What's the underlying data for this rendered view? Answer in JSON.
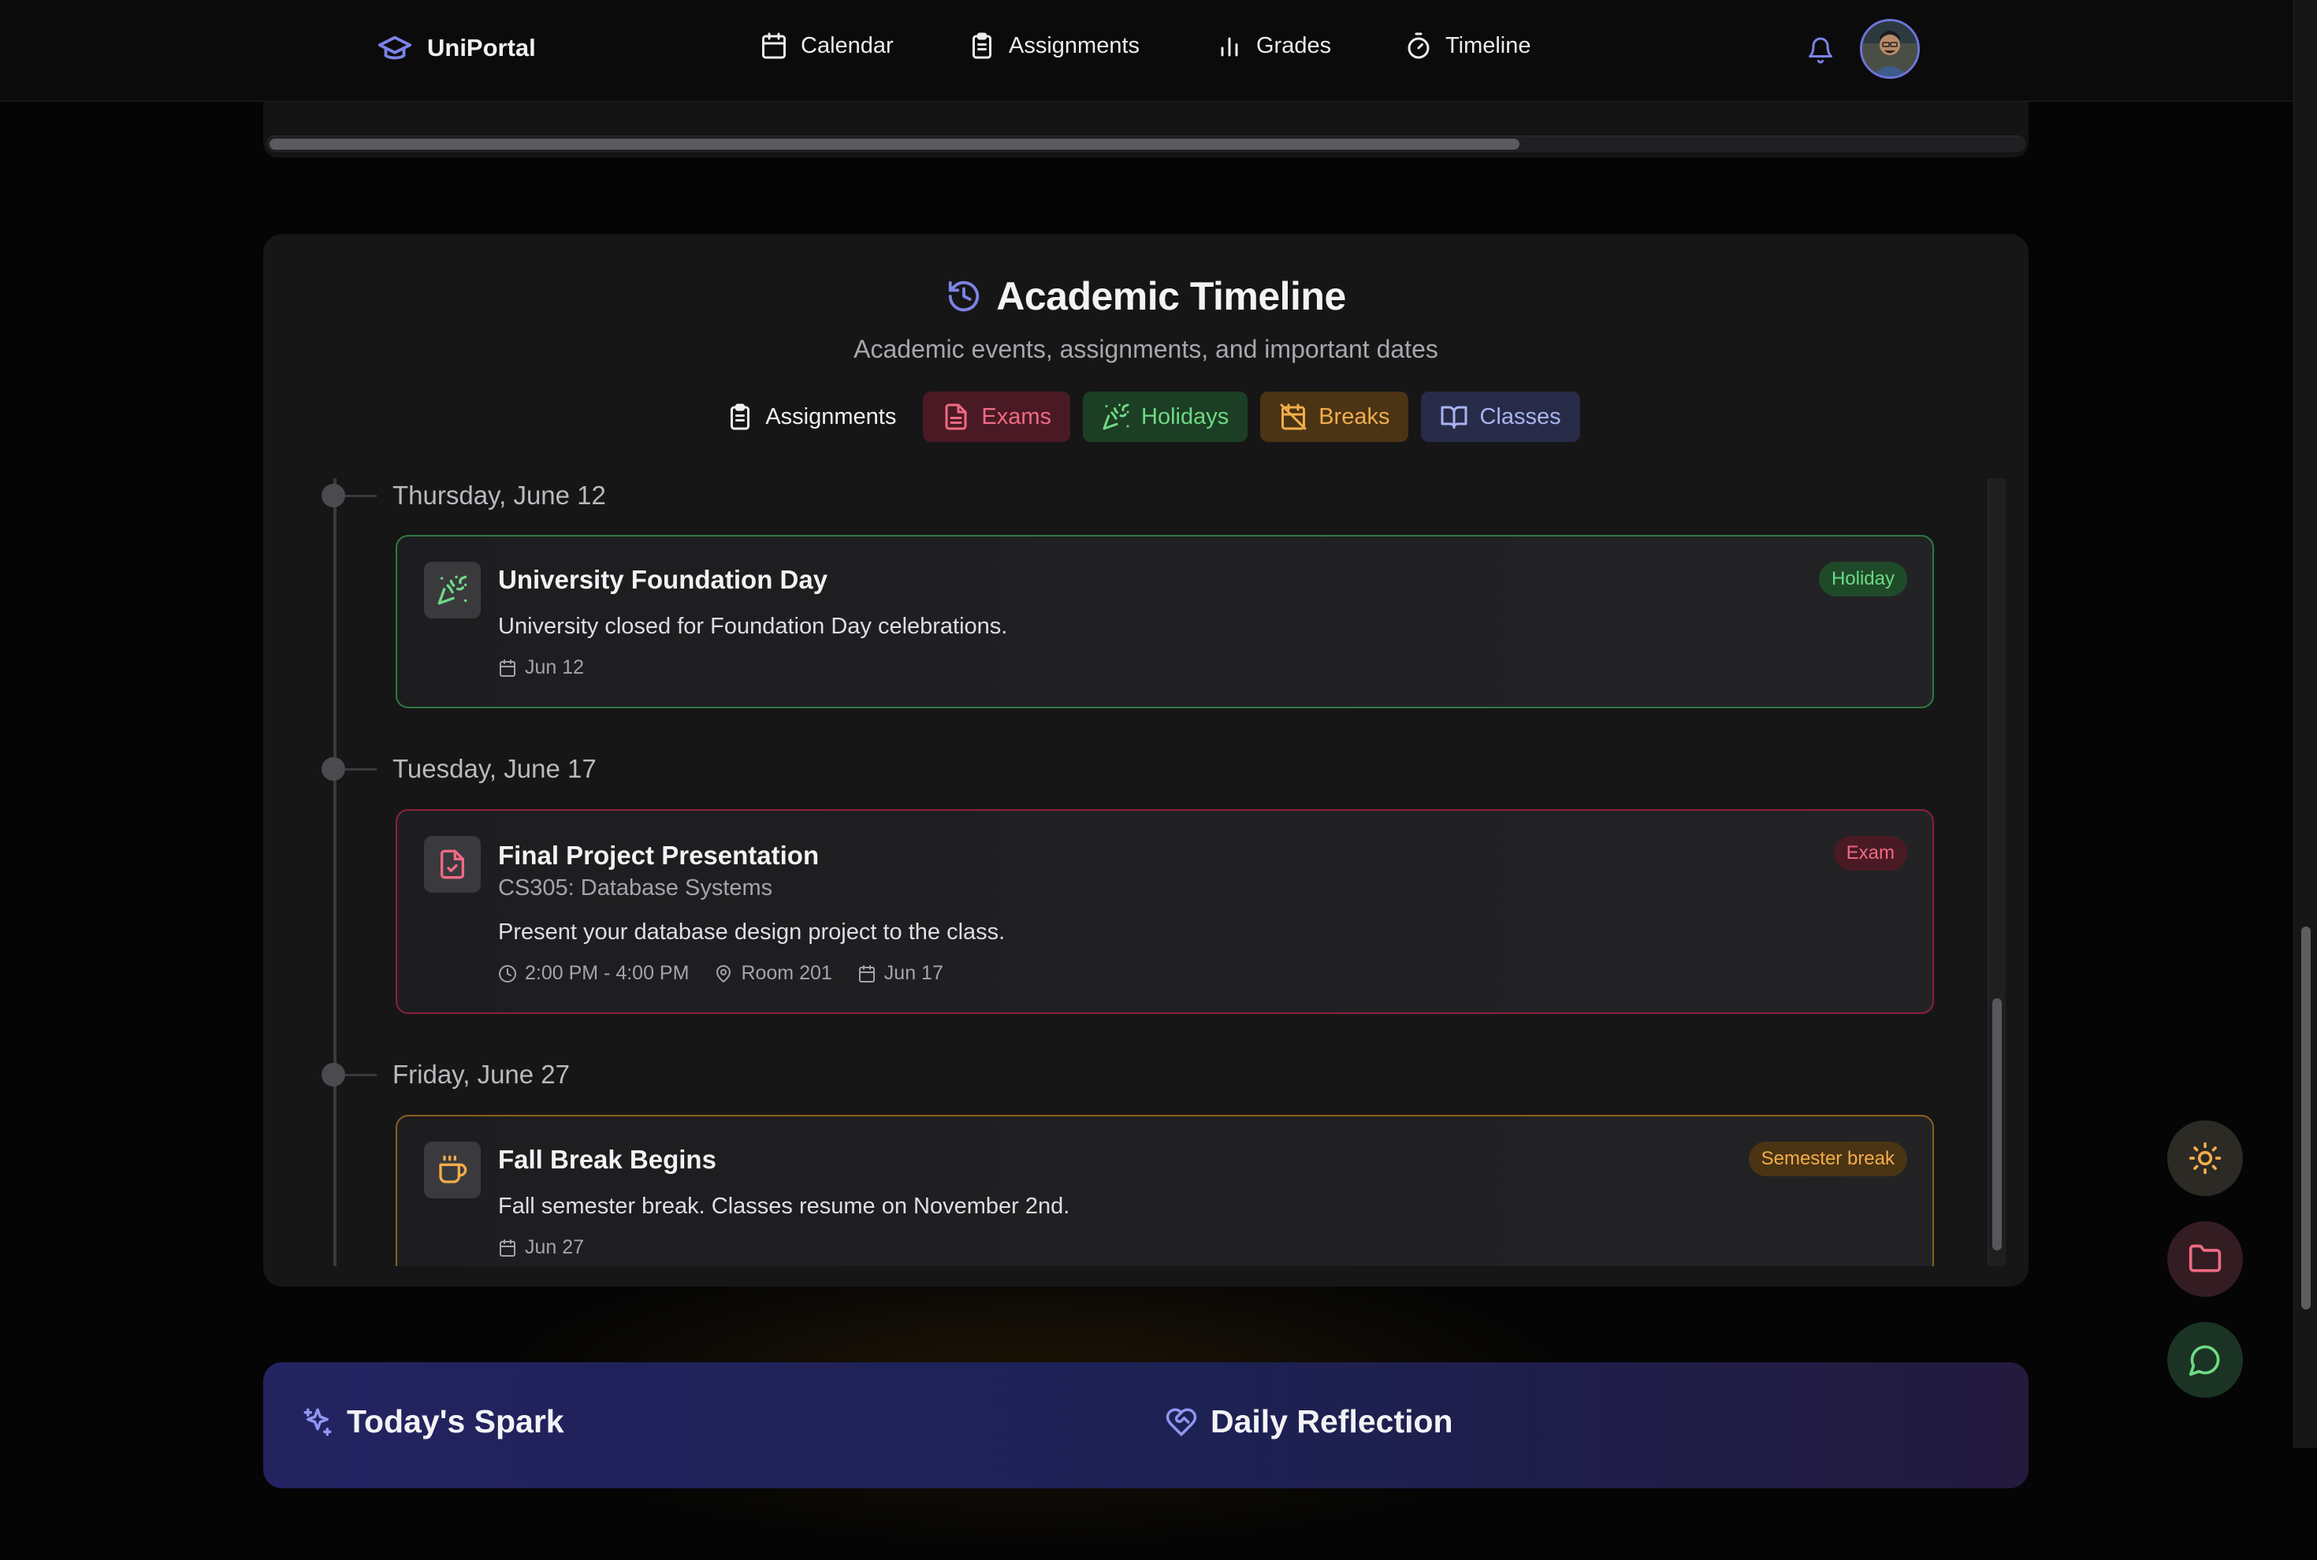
{
  "app": {
    "brand": "UniPortal"
  },
  "nav": {
    "items": [
      {
        "label": "Calendar",
        "icon": "calendar-icon"
      },
      {
        "label": "Assignments",
        "icon": "clipboard-icon"
      },
      {
        "label": "Grades",
        "icon": "bar-chart-icon"
      },
      {
        "label": "Timeline",
        "icon": "timer-icon"
      }
    ]
  },
  "timeline": {
    "title": "Academic Timeline",
    "subtitle": "Academic events, assignments, and important dates",
    "filters": [
      {
        "label": "Assignments",
        "icon": "clipboard-icon"
      },
      {
        "label": "Exams",
        "icon": "file-text-icon",
        "color": "#f06a84"
      },
      {
        "label": "Holidays",
        "icon": "party-popper-icon",
        "color": "#6fd983"
      },
      {
        "label": "Breaks",
        "icon": "calendar-off-icon",
        "color": "#f2ad4b"
      },
      {
        "label": "Classes",
        "icon": "book-open-icon",
        "color": "#a9b4ef"
      }
    ],
    "groups": [
      {
        "date": "Thursday, June 12",
        "event": {
          "title": "University Foundation Day",
          "description": "University closed for Foundation Day celebrations.",
          "date_short": "Jun 12",
          "badge": "Holiday",
          "icon": "party-popper-icon"
        }
      },
      {
        "date": "Tuesday, June 17",
        "event": {
          "title": "Final Project Presentation",
          "course": "CS305: Database Systems",
          "description": "Present your database design project to the class.",
          "time": "2:00 PM - 4:00 PM",
          "location": "Room 201",
          "date_short": "Jun 17",
          "badge": "Exam",
          "icon": "file-check-icon"
        }
      },
      {
        "date": "Friday, June 27",
        "event": {
          "title": "Fall Break Begins",
          "description": "Fall semester break. Classes resume on November 2nd.",
          "date_short": "Jun 27",
          "badge": "Semester break",
          "icon": "coffee-icon"
        }
      }
    ]
  },
  "bottom": {
    "spark_title": "Today's Spark",
    "reflection_title": "Daily Reflection"
  },
  "colors": {
    "accent": "#6d74d9",
    "holiday": "#6fd983",
    "exam": "#f06a84",
    "break": "#f2ad4b",
    "classes": "#a9b4ef"
  }
}
